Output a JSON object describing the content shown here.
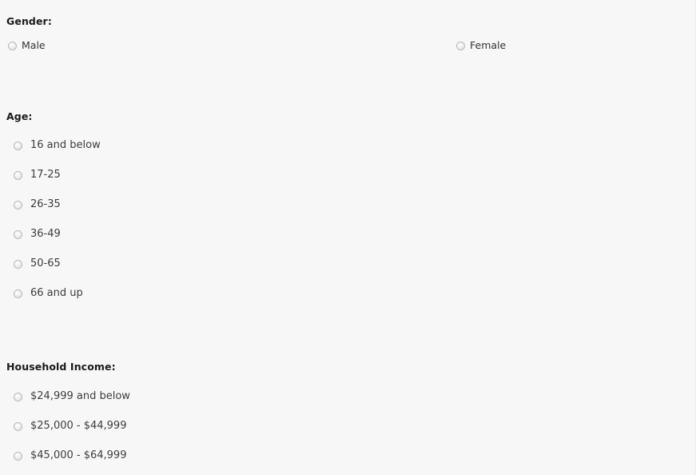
{
  "colors": {
    "background": "#f7f7f7",
    "heading_text": "#1a1a1a",
    "label_text": "#3d3d3d",
    "radio_border": "#b9b9b9",
    "radio_fill": "#ececec"
  },
  "form": {
    "gender": {
      "heading": "Gender:",
      "options": [
        {
          "label": "Male",
          "checked": false
        },
        {
          "label": "Female",
          "checked": false
        }
      ]
    },
    "age": {
      "heading": "Age:",
      "options": [
        {
          "label": "16 and below",
          "checked": false
        },
        {
          "label": "17-25",
          "checked": false
        },
        {
          "label": "26-35",
          "checked": false
        },
        {
          "label": "36-49",
          "checked": false
        },
        {
          "label": "50-65",
          "checked": false
        },
        {
          "label": "66 and up",
          "checked": false
        }
      ]
    },
    "household_income": {
      "heading": "Household Income:",
      "options": [
        {
          "label": "$24,999 and below",
          "checked": false
        },
        {
          "label": "$25,000 - $44,999",
          "checked": false
        },
        {
          "label": "$45,000 - $64,999",
          "checked": false
        }
      ]
    }
  }
}
